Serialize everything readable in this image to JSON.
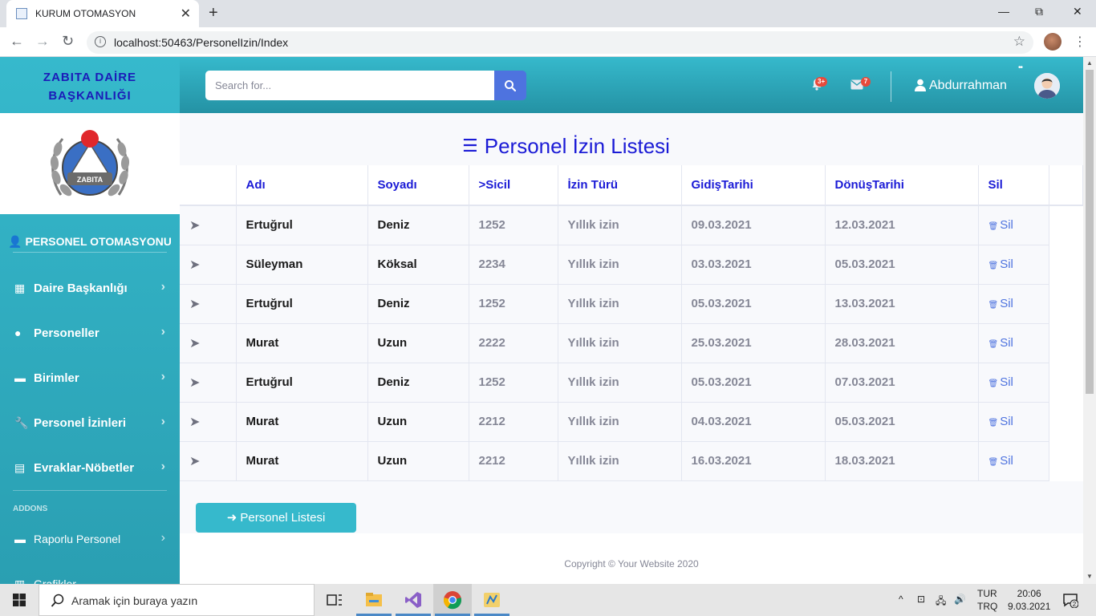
{
  "browser": {
    "tab_title": "KURUM OTOMASYON",
    "url": "localhost:50463/PersonelIzin/Index",
    "new_tab": "+",
    "close_tab": "✕",
    "minimize": "—",
    "restore": "⧉",
    "close_window": "✕"
  },
  "sidebar": {
    "brand_line1": "ZABITA DAİRE",
    "brand_line2": "BAŞKANLIĞI",
    "logo_text": "ZABITA",
    "heading": "PERSONEL OTOMASYONU",
    "items": [
      {
        "label": "Daire Başkanlığı",
        "icon": "table-icon"
      },
      {
        "label": "Personeller",
        "icon": "user-icon"
      },
      {
        "label": "Birimler",
        "icon": "folder-icon"
      },
      {
        "label": "Personel İzinleri",
        "icon": "wrench-icon"
      },
      {
        "label": "Evraklar-Nöbetler",
        "icon": "file-icon"
      }
    ],
    "addons_label": "ADDONS",
    "addon_items": [
      {
        "label": "Raporlu Personel",
        "icon": "folder-icon"
      },
      {
        "label": "Grafikler",
        "icon": "chart-icon"
      }
    ]
  },
  "topbar": {
    "search_placeholder": "Search for...",
    "alerts_badge": "3+",
    "messages_badge": "7",
    "username": "Abdurrahman"
  },
  "main": {
    "title": "Personel İzin Listesi",
    "columns": [
      "",
      "Adı",
      "Soyadı",
      ">Sicil",
      "İzin Türü",
      "GidişTarihi",
      "DönüşTarihi",
      "Sil"
    ],
    "rows": [
      {
        "arrow": "➤",
        "ad": "Ertuğrul",
        "soyad": "Deniz",
        "sicil": "1252",
        "tur": "Yıllık izin",
        "gidis": "09.03.2021",
        "donus": "12.03.2021",
        "sil": "Sil"
      },
      {
        "arrow": "➤",
        "ad": "Süleyman",
        "soyad": "Köksal",
        "sicil": "2234",
        "tur": "Yıllık izin",
        "gidis": "03.03.2021",
        "donus": "05.03.2021",
        "sil": "Sil"
      },
      {
        "arrow": "➤",
        "ad": "Ertuğrul",
        "soyad": "Deniz",
        "sicil": "1252",
        "tur": "Yıllık izin",
        "gidis": "05.03.2021",
        "donus": "13.03.2021",
        "sil": "Sil"
      },
      {
        "arrow": "➤",
        "ad": "Murat",
        "soyad": "Uzun",
        "sicil": "2222",
        "tur": "Yıllık izin",
        "gidis": "25.03.2021",
        "donus": "28.03.2021",
        "sil": "Sil"
      },
      {
        "arrow": "➤",
        "ad": "Ertuğrul",
        "soyad": "Deniz",
        "sicil": "1252",
        "tur": "Yıllık izin",
        "gidis": "05.03.2021",
        "donus": "07.03.2021",
        "sil": "Sil"
      },
      {
        "arrow": "➤",
        "ad": "Murat",
        "soyad": "Uzun",
        "sicil": "2212",
        "tur": "Yıllık izin",
        "gidis": "04.03.2021",
        "donus": "05.03.2021",
        "sil": "Sil"
      },
      {
        "arrow": "➤",
        "ad": "Murat",
        "soyad": "Uzun",
        "sicil": "2212",
        "tur": "Yıllık izin",
        "gidis": "16.03.2021",
        "donus": "18.03.2021",
        "sil": "Sil"
      }
    ],
    "list_button": "➜ Personel Listesi",
    "footer": "Copyright © Your Website 2020"
  },
  "taskbar": {
    "search_text": "Aramak için buraya yazın",
    "lang_line1": "TUR",
    "lang_line2": "TRQ",
    "time": "20:06",
    "date": "9.03.2021",
    "notification_count": "2"
  },
  "colors": {
    "sidebar": "#36b9cc",
    "primary": "#4e73df",
    "heading_blue": "#1b1bd6",
    "danger": "#e74a3b"
  }
}
